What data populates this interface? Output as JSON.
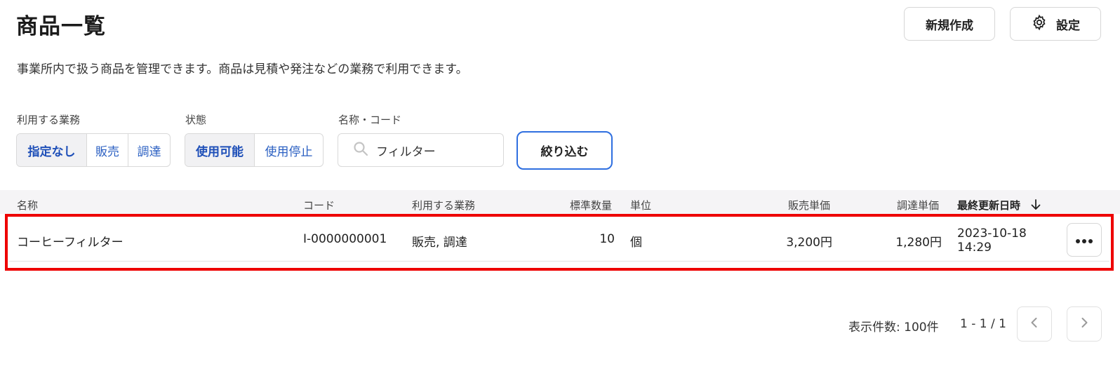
{
  "header": {
    "title": "商品一覧",
    "description": "事業所内で扱う商品を管理できます。商品は見積や発注などの業務で利用できます。",
    "new_button": "新規作成",
    "settings_button": "設定"
  },
  "filters": {
    "business": {
      "label": "利用する業務",
      "options": [
        "指定なし",
        "販売",
        "調達"
      ],
      "selected": "指定なし"
    },
    "status": {
      "label": "状態",
      "options": [
        "使用可能",
        "使用停止"
      ],
      "selected": "使用可能"
    },
    "search": {
      "label": "名称・コード",
      "value": "フィルター"
    },
    "apply_button": "絞り込む"
  },
  "table": {
    "columns": [
      "名称",
      "コード",
      "利用する業務",
      "標準数量",
      "単位",
      "販売単価",
      "調達単価",
      "最終更新日時"
    ],
    "sort": {
      "column": "最終更新日時",
      "direction": "desc",
      "icon": "arrow-down-icon"
    },
    "rows": [
      {
        "name": "コーヒーフィルター",
        "code": "I-0000000001",
        "business": "販売, 調達",
        "quantity": "10",
        "unit": "個",
        "sales_price": "3,200円",
        "purchase_price": "1,280円",
        "updated_at": "2023-10-18 14:29"
      }
    ]
  },
  "pagination": {
    "count_label": "表示件数: 100件",
    "range": "1 - 1 / 1"
  },
  "colors": {
    "accent": "#2f6fe0",
    "link": "#2a5fc2",
    "highlight": "#ee0000",
    "header_bg": "#f5f4f6"
  }
}
